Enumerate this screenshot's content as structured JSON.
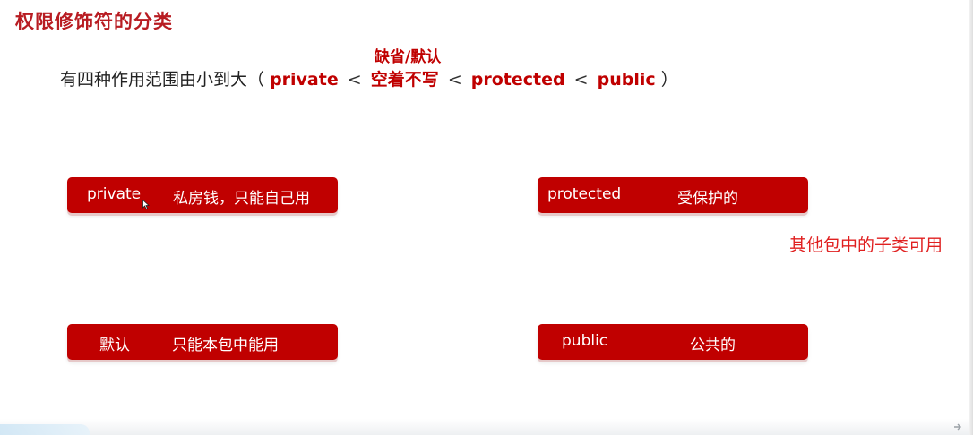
{
  "title": "权限修饰符的分类",
  "annotation_top": "缺省/默认",
  "description": {
    "prefix": "有四种作用范围由小到大（",
    "kw1": "private",
    "lt1": "<",
    "kw2": "空着不写",
    "lt2": "<",
    "kw3": "protected",
    "lt3": "<",
    "kw4": "public",
    "suffix": "）"
  },
  "cards": {
    "private": {
      "keyword": "private",
      "meaning": "私房钱，只能自己用"
    },
    "protected": {
      "keyword": "protected",
      "meaning": "受保护的"
    },
    "default": {
      "keyword": "默认",
      "meaning": "只能本包中能用"
    },
    "public": {
      "keyword": "public",
      "meaning": "公共的"
    }
  },
  "side_note": "其他包中的子类可用",
  "colors": {
    "accent": "#c00000",
    "title": "#b81c22",
    "note": "#e02020"
  }
}
